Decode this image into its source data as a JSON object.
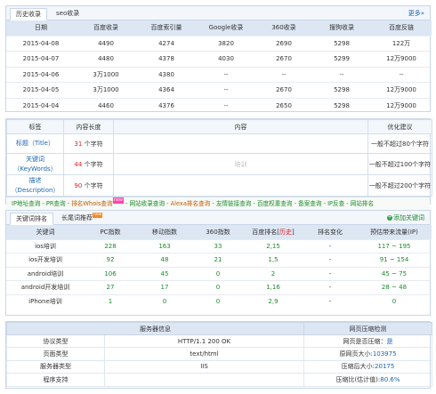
{
  "history": {
    "tabs": [
      "历史收录",
      "seo收录"
    ],
    "more": "更多»",
    "headers": [
      "日期",
      "百度收录",
      "百度索引量",
      "Google收录",
      "360收录",
      "搜狗收录",
      "百度反链"
    ],
    "rows": [
      [
        "2015-04-08",
        "4490",
        "4274",
        "3820",
        "2690",
        "5298",
        "122万"
      ],
      [
        "2015-04-07",
        "4480",
        "4378",
        "4030",
        "2670",
        "5299",
        "12万9000"
      ],
      [
        "2015-04-06",
        "3万1000",
        "4380",
        "--",
        "--",
        "--",
        "--"
      ],
      [
        "2015-04-05",
        "3万1000",
        "4364",
        "--",
        "2670",
        "5298",
        "12万9000"
      ],
      [
        "2015-04-04",
        "4460",
        "4376",
        "--",
        "2650",
        "5298",
        "12万9000"
      ]
    ]
  },
  "tdk": {
    "headers": [
      "标签",
      "内容长度",
      "内容",
      "优化建议"
    ],
    "rows": [
      {
        "label_line1": "标题",
        "label_line2": "（Title）",
        "length_num": "31",
        "length_unit": "个字符",
        "content": "",
        "advice": "一般不超过80个字符"
      },
      {
        "label_line1": "关键词",
        "label_line2": "（KeyWords）",
        "length_num": "44",
        "length_unit": "个字符",
        "content": "培训",
        "advice": "一般不超过100个字符"
      },
      {
        "label_line1": "描述",
        "label_line2": "（Description）",
        "length_num": "90",
        "length_unit": "个字符",
        "content": "",
        "advice": "一般不超过200个字符"
      }
    ]
  },
  "tools": {
    "items": [
      "IP地址查询",
      "PR查询",
      "排名Whois查询",
      "网站收录查询",
      "Alexa排名查询",
      "友情链接查询",
      "百度权重查询",
      "备案查询",
      "IP反查",
      "网站排名"
    ],
    "alt_indexes": [
      2,
      4
    ],
    "new_tag": "new"
  },
  "keywords": {
    "tabs": [
      "关键词排名",
      "长尾词推荐"
    ],
    "new_tag": "new",
    "add_button": "添加关键词",
    "headers": [
      "关键词",
      "PC指数",
      "移动指数",
      "360指数",
      "百度排名",
      "历史",
      "排名变化",
      "预估带来流量(IP)"
    ],
    "rows": [
      [
        "ios培训",
        "228",
        "163",
        "33",
        "2,15",
        "-",
        "117 ~ 195"
      ],
      [
        "ios开发培训",
        "92",
        "48",
        "21",
        "1,5",
        "-",
        "91 ~ 154"
      ],
      [
        "android培训",
        "106",
        "45",
        "0",
        "2",
        "-",
        "45 ~ 75"
      ],
      [
        "android开发培训",
        "27",
        "17",
        "0",
        "1,16",
        "-",
        "28 ~ 48"
      ],
      [
        "iPhone培训",
        "1",
        "0",
        "0",
        "2,9",
        "-",
        "0"
      ]
    ]
  },
  "server": {
    "headers": [
      "服务器信息",
      "网页压缩检测"
    ],
    "rows": [
      {
        "label": "协议类型",
        "value": "HTTP/1.1 200 OK",
        "check_label": "网页是否压缩：",
        "check_value": "是"
      },
      {
        "label": "页面类型",
        "value": "text/html",
        "check_label": "原网页大小:",
        "check_value": "103975"
      },
      {
        "label": "服务器类型",
        "value": "IIS",
        "check_label": "压缩后大小:",
        "check_value": "20175"
      },
      {
        "label": "程序支持",
        "value": "",
        "check_label": "压缩比(估计值):",
        "check_value": "80.6%"
      }
    ]
  }
}
